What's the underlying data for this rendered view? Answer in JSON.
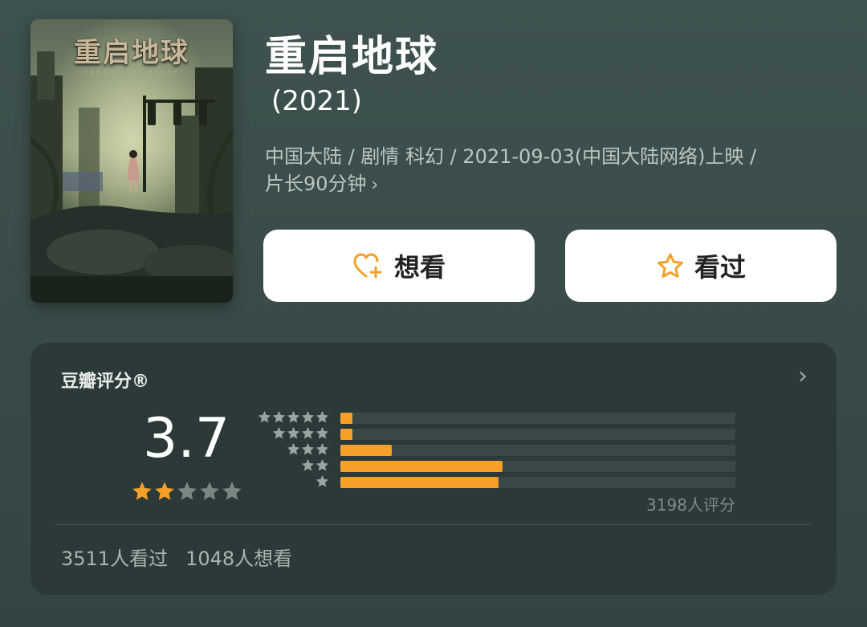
{
  "poster": {
    "title": "重启地球",
    "subtitle": "REBOOT THE EARTH"
  },
  "movie": {
    "title": "重启地球",
    "year": "(2021)",
    "meta_line1": "中国大陆 / 剧情 科幻 / 2021-09-03(中国大陆网络)上映 /",
    "meta_line2": "片长90分钟"
  },
  "actions": {
    "want_label": "想看",
    "seen_label": "看过"
  },
  "rating": {
    "title": "豆瓣评分®",
    "score": "3.7",
    "score_stars": 2,
    "distribution": [
      {
        "stars": 5,
        "fraction": 0.03
      },
      {
        "stars": 4,
        "fraction": 0.03
      },
      {
        "stars": 3,
        "fraction": 0.13
      },
      {
        "stars": 2,
        "fraction": 0.41
      },
      {
        "stars": 1,
        "fraction": 0.4
      }
    ],
    "count_text": "3198人评分",
    "seen_text": "3511人看过",
    "want_text": "1048人想看"
  },
  "colors": {
    "accent": "#f6a02a",
    "star_empty": "#7b8784",
    "dist_star": "#9aa4a2"
  }
}
